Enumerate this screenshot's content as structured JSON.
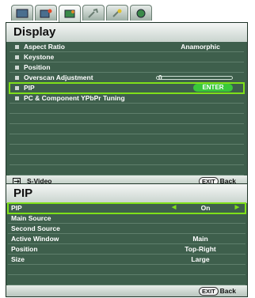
{
  "tabs": [
    {
      "icon": "picture-icon"
    },
    {
      "icon": "picture-advanced-icon"
    },
    {
      "icon": "display-icon",
      "active": true
    },
    {
      "icon": "settings-icon"
    },
    {
      "icon": "advanced-settings-icon"
    },
    {
      "icon": "information-icon"
    }
  ],
  "display": {
    "title": "Display",
    "items": [
      {
        "label": "Aspect Ratio",
        "value": "Anamorphic"
      },
      {
        "label": "Keystone",
        "value": ""
      },
      {
        "label": "Position",
        "value": ""
      },
      {
        "label": "Overscan Adjustment",
        "value": "0"
      },
      {
        "label": "PIP",
        "value": "ENTER"
      },
      {
        "label": "PC & Component YPbPr Tuning",
        "value": ""
      }
    ],
    "footer_source": "S-Video",
    "footer_exit": "EXIT",
    "footer_back": "Back"
  },
  "pip": {
    "title": "PIP",
    "items": [
      {
        "label": "PIP",
        "value": "On"
      },
      {
        "label": "Main Source",
        "value": ""
      },
      {
        "label": "Second Source",
        "value": ""
      },
      {
        "label": "Active Window",
        "value": "Main"
      },
      {
        "label": "Position",
        "value": "Top-Right"
      },
      {
        "label": "Size",
        "value": "Large"
      }
    ],
    "footer_exit": "EXIT",
    "footer_back": "Back"
  },
  "colors": {
    "menu_bg": "#3e5f4c",
    "highlight": "#7fe01a",
    "enter_button": "#39c83a"
  }
}
